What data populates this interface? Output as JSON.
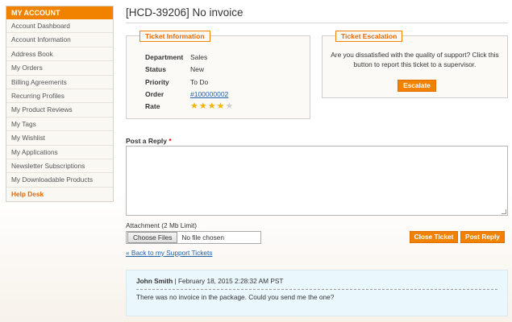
{
  "sidebar": {
    "title": "MY ACCOUNT",
    "items": [
      {
        "label": "Account Dashboard"
      },
      {
        "label": "Account Information"
      },
      {
        "label": "Address Book"
      },
      {
        "label": "My Orders"
      },
      {
        "label": "Billing Agreements"
      },
      {
        "label": "Recurring Profiles"
      },
      {
        "label": "My Product Reviews"
      },
      {
        "label": "My Tags"
      },
      {
        "label": "My Wishlist"
      },
      {
        "label": "My Applications"
      },
      {
        "label": "Newsletter Subscriptions"
      },
      {
        "label": "My Downloadable Products"
      },
      {
        "label": "Help Desk",
        "active": true
      }
    ]
  },
  "page": {
    "title": "[HCD-39206] No invoice"
  },
  "ticket_info": {
    "legend": "Ticket Information",
    "rows": [
      {
        "label": "Department",
        "value": "Sales"
      },
      {
        "label": "Status",
        "value": "New"
      },
      {
        "label": "Priority",
        "value": "To Do"
      },
      {
        "label": "Order",
        "value": "#100000002"
      },
      {
        "label": "Rate",
        "value": ""
      }
    ],
    "rating": 4,
    "rating_max": 5
  },
  "escalation": {
    "legend": "Ticket Escalation",
    "text": "Are you dissatisfied with the quality of support? Click this button to report this ticket to a supervisor.",
    "button": "Escalate"
  },
  "reply": {
    "label": "Post a Reply",
    "required_mark": "*",
    "attachment_label": "Attachment (2 Mb Limit)",
    "choose_button": "Choose Files",
    "no_file_text": "No file chosen",
    "close_button": "Close Ticket",
    "post_button": "Post Reply",
    "back_link": "« Back to my Support Tickets"
  },
  "messages": [
    {
      "author": "John Smith",
      "separator": "|",
      "date": "February 18, 2015 2:28:32 AM PST",
      "text": "There was no invoice in the package. Could you send me the one?"
    }
  ],
  "colors": {
    "accent": "#f18200",
    "link": "#1e5fa8",
    "star_on": "#f0b400",
    "star_off": "#cfcfcf",
    "message_bg": "#eaf7fd"
  }
}
